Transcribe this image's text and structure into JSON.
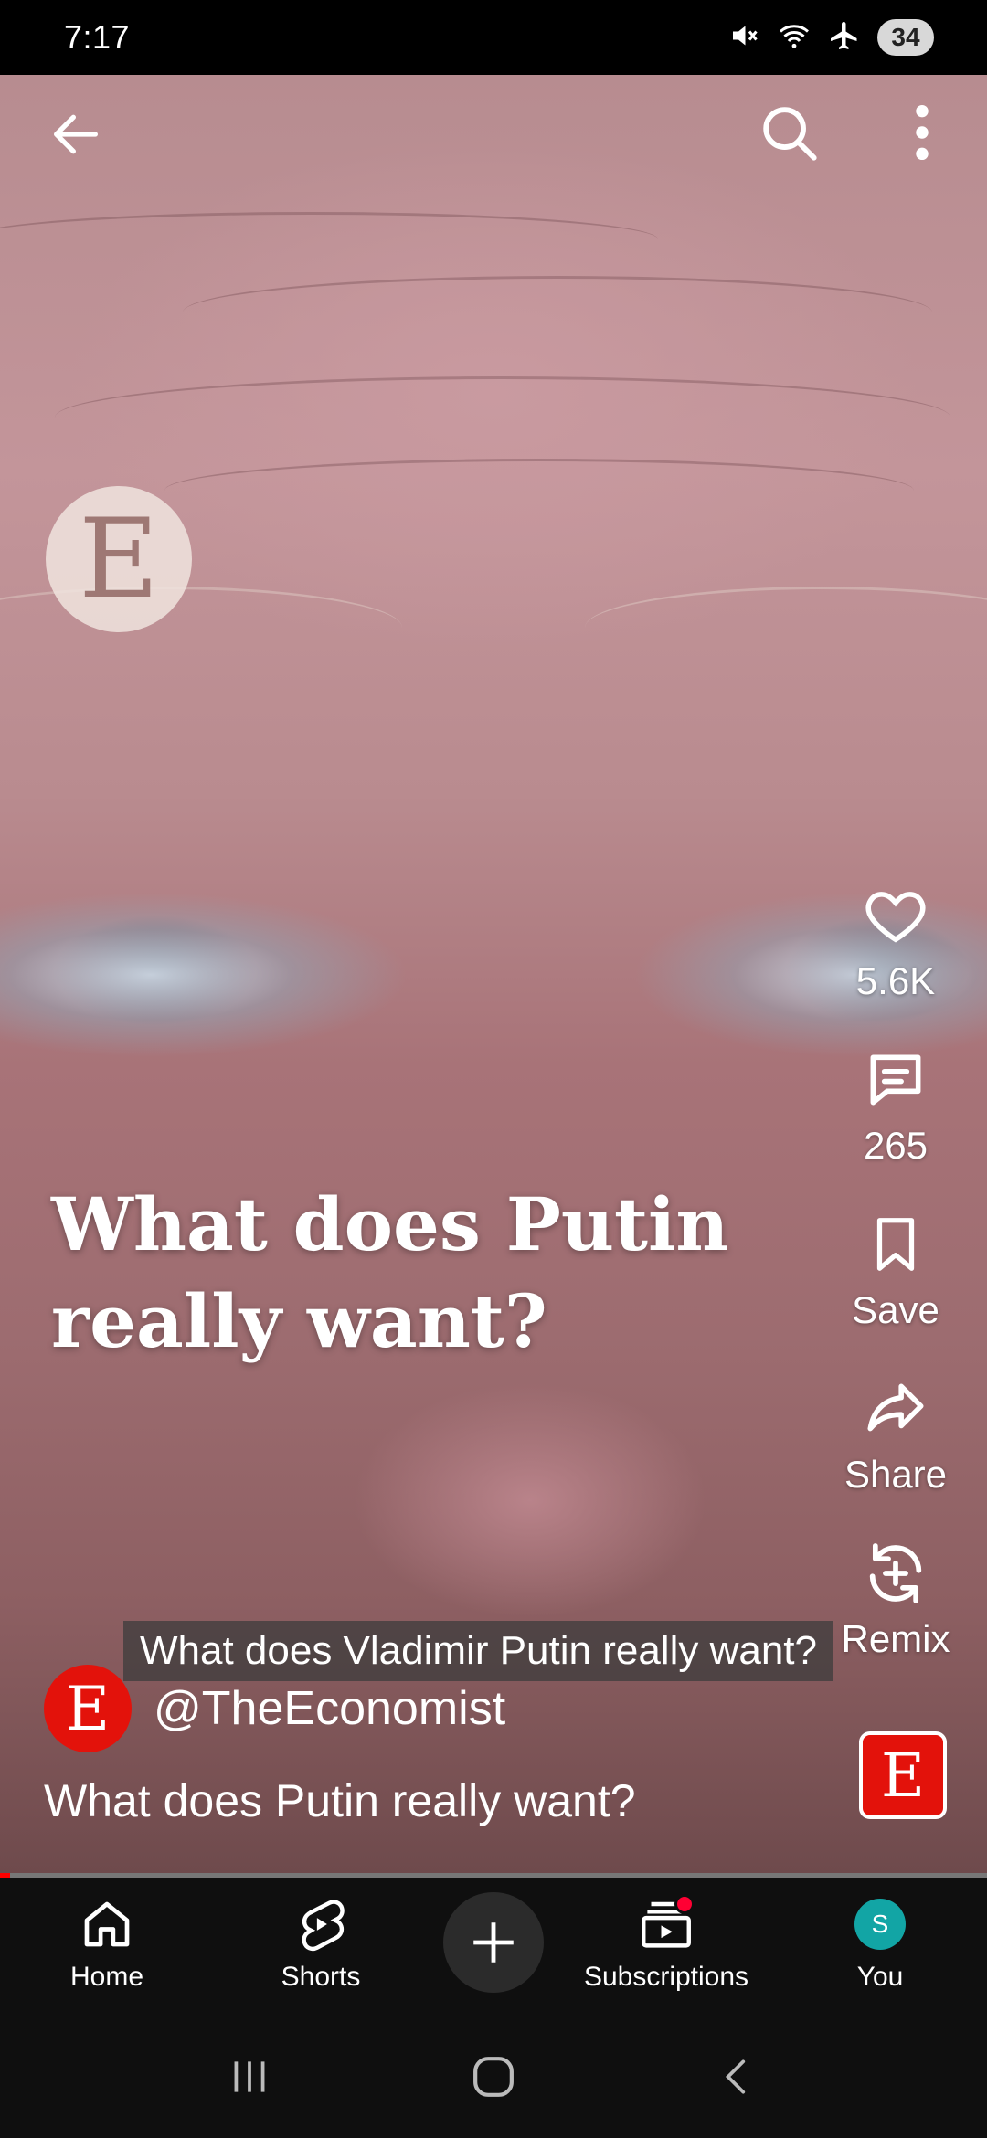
{
  "status_bar": {
    "time": "7:17",
    "battery": "34",
    "icons": [
      "mute-icon",
      "wifi-icon",
      "airplane-icon",
      "battery-icon"
    ]
  },
  "top_nav": {
    "icons": [
      "back-arrow-icon",
      "search-icon",
      "more-vert-icon"
    ]
  },
  "video": {
    "watermark_letter": "E",
    "overlay_title_line1": "What does Putin",
    "overlay_title_line2": "really want?",
    "caption": "What does Vladimir Putin really want?",
    "progress": 0.01
  },
  "actions": {
    "like_count": "5.6K",
    "comment_count": "265",
    "save_label": "Save",
    "share_label": "Share",
    "remix_label": "Remix"
  },
  "channel": {
    "avatar_letter": "E",
    "handle": "@TheEconomist",
    "brand_color": "#e3120b"
  },
  "description": "What does Putin really want?",
  "bottom_nav": {
    "home": "Home",
    "shorts": "Shorts",
    "subscriptions": "Subscriptions",
    "you": "You",
    "you_avatar_letter": "S"
  }
}
